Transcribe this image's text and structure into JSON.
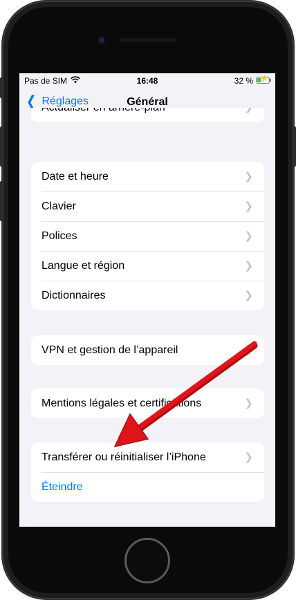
{
  "status_bar": {
    "carrier": "Pas de SIM",
    "time": "16:48",
    "battery_percent": "32 %",
    "battery_level": 0.32,
    "battery_color": "#34c759"
  },
  "nav": {
    "back_label": "Réglages",
    "title": "Général"
  },
  "groups": {
    "top": {
      "items": [
        {
          "label": "Actualiser en arrière-plan"
        }
      ]
    },
    "datetime": {
      "items": [
        {
          "label": "Date et heure"
        },
        {
          "label": "Clavier"
        },
        {
          "label": "Polices"
        },
        {
          "label": "Langue et région"
        },
        {
          "label": "Dictionnaires"
        }
      ]
    },
    "vpn": {
      "items": [
        {
          "label": "VPN et gestion de l’appareil"
        }
      ]
    },
    "legal": {
      "items": [
        {
          "label": "Mentions légales et certifications"
        }
      ]
    },
    "reset": {
      "items": [
        {
          "label": "Transférer ou réinitialiser l’iPhone"
        },
        {
          "label": "Éteindre"
        }
      ]
    }
  },
  "colors": {
    "accent": "#007aff",
    "background": "#f2f2f7",
    "annotation_arrow": "#e0151b"
  },
  "icons": [
    "wifi-icon",
    "battery-icon",
    "back-chevron-icon",
    "disclosure-chevron-icon",
    "annotation-arrow"
  ]
}
